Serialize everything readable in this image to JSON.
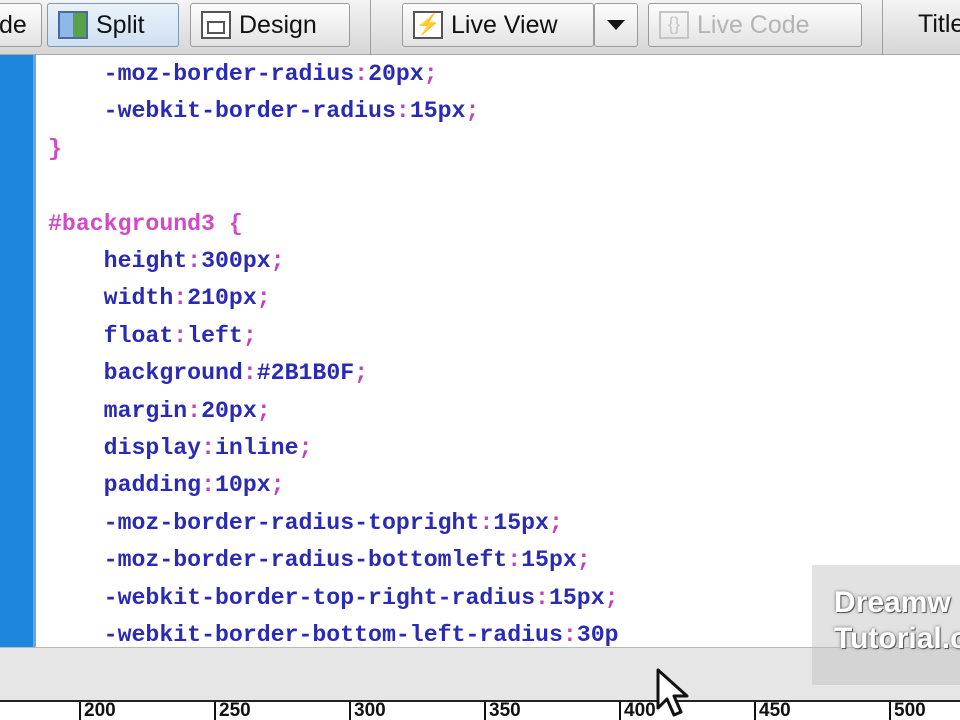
{
  "toolbar": {
    "code_partial_label": "de",
    "split_label": "Split",
    "design_label": "Design",
    "live_view_label": "Live View",
    "live_code_label": "Live Code",
    "title_partial_label": "Title"
  },
  "code_lines": [
    [
      {
        "t": "    "
      },
      {
        "c": "prop",
        "t": "-moz-border-radius"
      },
      {
        "c": "punc",
        "t": ":"
      },
      {
        "c": "val",
        "t": "20px"
      },
      {
        "c": "punc",
        "t": ";"
      }
    ],
    [
      {
        "t": "    "
      },
      {
        "c": "prop",
        "t": "-webkit-border-radius"
      },
      {
        "c": "punc",
        "t": ":"
      },
      {
        "c": "val",
        "t": "15px"
      },
      {
        "c": "punc",
        "t": ";"
      }
    ],
    [
      {
        "c": "sel",
        "t": "}"
      }
    ],
    [],
    [
      {
        "c": "sel",
        "t": "#background3 {"
      }
    ],
    [
      {
        "t": "    "
      },
      {
        "c": "prop",
        "t": "height"
      },
      {
        "c": "punc",
        "t": ":"
      },
      {
        "c": "val",
        "t": "300px"
      },
      {
        "c": "punc",
        "t": ";"
      }
    ],
    [
      {
        "t": "    "
      },
      {
        "c": "prop",
        "t": "width"
      },
      {
        "c": "punc",
        "t": ":"
      },
      {
        "c": "val",
        "t": "210px"
      },
      {
        "c": "punc",
        "t": ";"
      }
    ],
    [
      {
        "t": "    "
      },
      {
        "c": "prop",
        "t": "float"
      },
      {
        "c": "punc",
        "t": ":"
      },
      {
        "c": "val",
        "t": "left"
      },
      {
        "c": "punc",
        "t": ";"
      }
    ],
    [
      {
        "t": "    "
      },
      {
        "c": "prop",
        "t": "background"
      },
      {
        "c": "punc",
        "t": ":"
      },
      {
        "c": "val",
        "t": "#2B1B0F"
      },
      {
        "c": "punc",
        "t": ";"
      }
    ],
    [
      {
        "t": "    "
      },
      {
        "c": "prop",
        "t": "margin"
      },
      {
        "c": "punc",
        "t": ":"
      },
      {
        "c": "val",
        "t": "20px"
      },
      {
        "c": "punc",
        "t": ";"
      }
    ],
    [
      {
        "t": "    "
      },
      {
        "c": "prop",
        "t": "display"
      },
      {
        "c": "punc",
        "t": ":"
      },
      {
        "c": "val",
        "t": "inline"
      },
      {
        "c": "punc",
        "t": ";"
      }
    ],
    [
      {
        "t": "    "
      },
      {
        "c": "prop",
        "t": "padding"
      },
      {
        "c": "punc",
        "t": ":"
      },
      {
        "c": "val",
        "t": "10px"
      },
      {
        "c": "punc",
        "t": ";"
      }
    ],
    [
      {
        "t": "    "
      },
      {
        "c": "prop",
        "t": "-moz-border-radius-topright"
      },
      {
        "c": "punc",
        "t": ":"
      },
      {
        "c": "val",
        "t": "15px"
      },
      {
        "c": "punc",
        "t": ";"
      }
    ],
    [
      {
        "t": "    "
      },
      {
        "c": "prop",
        "t": "-moz-border-radius-bottomleft"
      },
      {
        "c": "punc",
        "t": ":"
      },
      {
        "c": "val",
        "t": "15px"
      },
      {
        "c": "punc",
        "t": ";"
      }
    ],
    [
      {
        "t": "    "
      },
      {
        "c": "prop",
        "t": "-webkit-border-top-right-radius"
      },
      {
        "c": "punc",
        "t": ":"
      },
      {
        "c": "val",
        "t": "15px"
      },
      {
        "c": "punc",
        "t": ";"
      }
    ],
    [
      {
        "t": "    "
      },
      {
        "c": "prop",
        "t": "-webkit-border-bottom-left-radius"
      },
      {
        "c": "punc",
        "t": ":"
      },
      {
        "c": "val",
        "t": "30p"
      }
    ]
  ],
  "ruler": {
    "labels": [
      "200",
      "250",
      "300",
      "350",
      "400",
      "450",
      "500"
    ]
  },
  "watermark": {
    "line1": "Dreamw",
    "line2": "Tutorial.c"
  },
  "colors": {
    "selector": "#d14ac6",
    "property": "#2a2ab4",
    "punctuation": "#c23fc2",
    "gutter": "#1f86dd"
  },
  "icons": {
    "split": "split-view-icon",
    "design": "design-view-icon",
    "live_view": "live-view-icon",
    "live_code": "live-code-icon",
    "cursor": "mouse-pointer-icon"
  }
}
